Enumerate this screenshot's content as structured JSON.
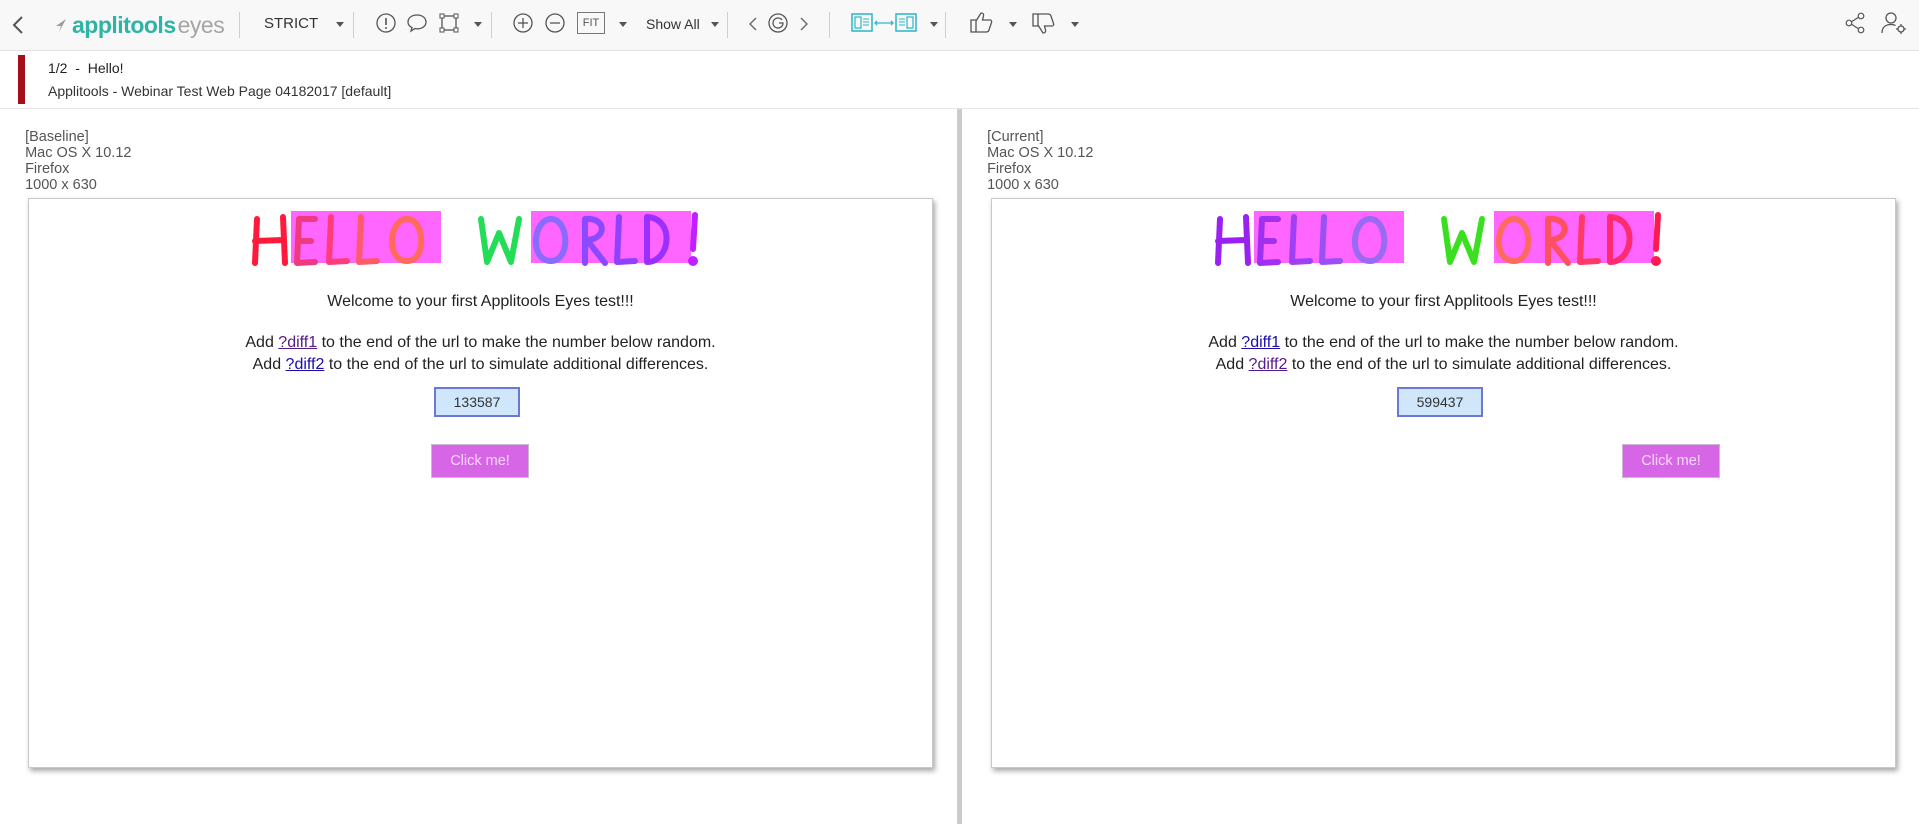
{
  "toolbar": {
    "brand_main": "applitools",
    "brand_sub": "eyes",
    "match_level": "STRICT",
    "fit_label": "FIT",
    "show_filter": "Show All"
  },
  "header": {
    "step_counter": "1/2",
    "step_separator": "-",
    "step_name": "Hello!",
    "test_name": "Applitools - Webinar Test Web Page 04182017 [default]"
  },
  "baseline": {
    "tag": "[Baseline]",
    "os": "Mac OS X 10.12",
    "browser": "Firefox",
    "viewport": "1000 x 630",
    "page": {
      "welcome": "Welcome to your first Applitools Eyes test!!!",
      "line1_pre": "Add ",
      "line1_link": "?diff1",
      "line1_post": " to the end of the url to make the number below random.",
      "line2_pre": "Add ",
      "line2_link": "?diff2",
      "line2_post": " to the end of the url to simulate additional differences.",
      "number": "133587",
      "button": "Click me!"
    }
  },
  "current": {
    "tag": "[Current]",
    "os": "Mac OS X 10.12",
    "browser": "Firefox",
    "viewport": "1000 x 630",
    "page": {
      "welcome": "Welcome to your first Applitools Eyes test!!!",
      "line1_pre": "Add ",
      "line1_link": "?diff1",
      "line1_post": " to the end of the url to make the number below random.",
      "line2_pre": "Add ",
      "line2_link": "?diff2",
      "line2_post": " to the end of the url to simulate additional differences.",
      "number": "599437",
      "button": "Click me!"
    }
  },
  "colors": {
    "brand": "#2db4a5",
    "diff_highlight": "#ff66ff",
    "step_marker": "#a50f1a",
    "click_button": "#d666e6"
  }
}
